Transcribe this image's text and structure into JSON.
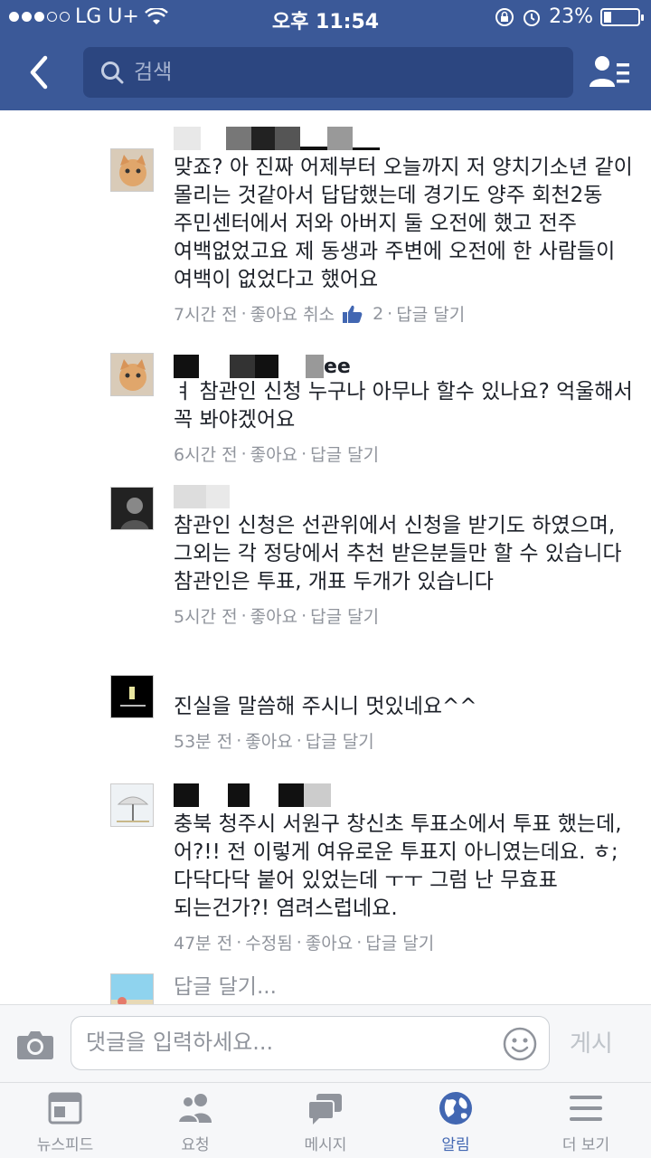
{
  "status": {
    "carrier": "LG U+",
    "time": "오후 11:54",
    "battery": "23%",
    "battery_level": 0.23
  },
  "nav": {
    "search_placeholder": "검색"
  },
  "comments": [
    {
      "text": "맞죠? 아 진짜 어제부터 오늘까지 저 양치기소년 같이 몰리는 것같아서 답답했는데 경기도 양주 회천2동 주민센터에서 저와 아버지 둘 오전에 했고 전주 여백없었고요 제 동생과 주변에 오전에 한 사람들이 여백이 없었다고 했어요",
      "time": "7시간 전",
      "like": "좋아요 취소",
      "likes": "2",
      "reply": "답글 달기"
    },
    {
      "name_visible": "ee",
      "text": "ㅕ 참관인 신청 누구나 아무나 할수 있나요? 억울해서 꼭 봐야겠어요",
      "time": "6시간 전",
      "like": "좋아요",
      "reply": "답글 달기"
    },
    {
      "text": "참관인 신청은 선관위에서 신청을 받기도 하였으며, 그외는 각 정당에서 추천 받은분들만 할 수 있습니다\n참관인은 투표, 개표 두개가 있습니다",
      "time": "5시간 전",
      "like": "좋아요",
      "reply": "답글 달기"
    },
    {
      "text": "진실을 말씀해 주시니 멋있네요^^",
      "time": "53분 전",
      "like": "좋아요",
      "reply": "답글 달기"
    },
    {
      "text": "충북 청주시 서원구 창신초 투표소에서 투표 했는데, 어?!! 전 이렇게 여유로운 투표지 아니였는데요. ㅎ; 다닥다닥 붙어 있었는데 ㅜㅜ 그럼 난 무효표 되는건가?! 염려스럽네요.",
      "time": "47분 전",
      "edited": "수정됨",
      "like": "좋아요",
      "reply": "답글 달기"
    }
  ],
  "reply_prompt": "답글 달기...",
  "composer": {
    "placeholder": "댓글을 입력하세요...",
    "post_label": "게시"
  },
  "tabs": [
    {
      "label": "뉴스피드",
      "icon": "news-feed-icon"
    },
    {
      "label": "요청",
      "icon": "friend-requests-icon"
    },
    {
      "label": "메시지",
      "icon": "messages-icon"
    },
    {
      "label": "알림",
      "icon": "globe-notifications-icon",
      "active": true
    },
    {
      "label": "더 보기",
      "icon": "menu-icon"
    }
  ],
  "colors": {
    "brand": "#3b5998",
    "link_blue": "#4267b2",
    "meta_gray": "#90949c"
  }
}
